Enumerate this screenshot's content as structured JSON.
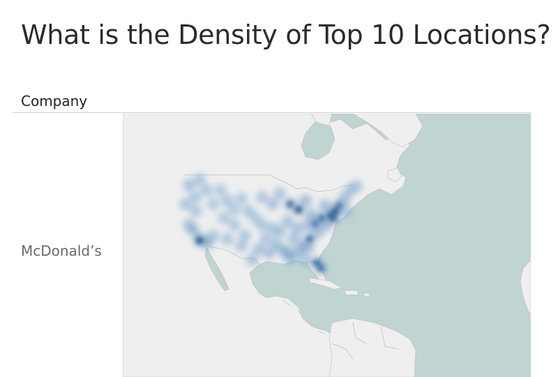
{
  "title": "What is the Density of Top 10 Locations?",
  "column_header": "Company",
  "rows": [
    {
      "label": "McDonald’s"
    }
  ],
  "map": {
    "type": "density-heatmap",
    "region": "North America",
    "colors": {
      "ocean": "#c0d4d2",
      "land": "#efefef",
      "border": "#bdbdbd",
      "density_low": "#9fc7ea",
      "density_high": "#1f4f86"
    }
  }
}
